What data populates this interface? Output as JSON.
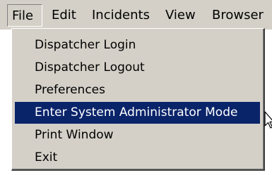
{
  "menubar": {
    "items": [
      {
        "label": "File",
        "active": true
      },
      {
        "label": "Edit",
        "active": false
      },
      {
        "label": "Incidents",
        "active": false
      },
      {
        "label": "View",
        "active": false
      },
      {
        "label": "Browser",
        "active": false
      }
    ]
  },
  "file_menu": {
    "items": [
      {
        "label": "Dispatcher Login"
      },
      {
        "label": "Dispatcher Logout"
      },
      {
        "label": "Preferences"
      },
      {
        "label": "Enter System Administrator Mode",
        "highlighted": true
      },
      {
        "label": "Print Window"
      },
      {
        "label": "Exit"
      }
    ]
  },
  "colors": {
    "menu_background": "#d4d0c8",
    "highlight_background": "#0a246a",
    "highlight_text": "#ffffff"
  },
  "icons": {
    "cursor": "arrow-pointer-icon"
  }
}
